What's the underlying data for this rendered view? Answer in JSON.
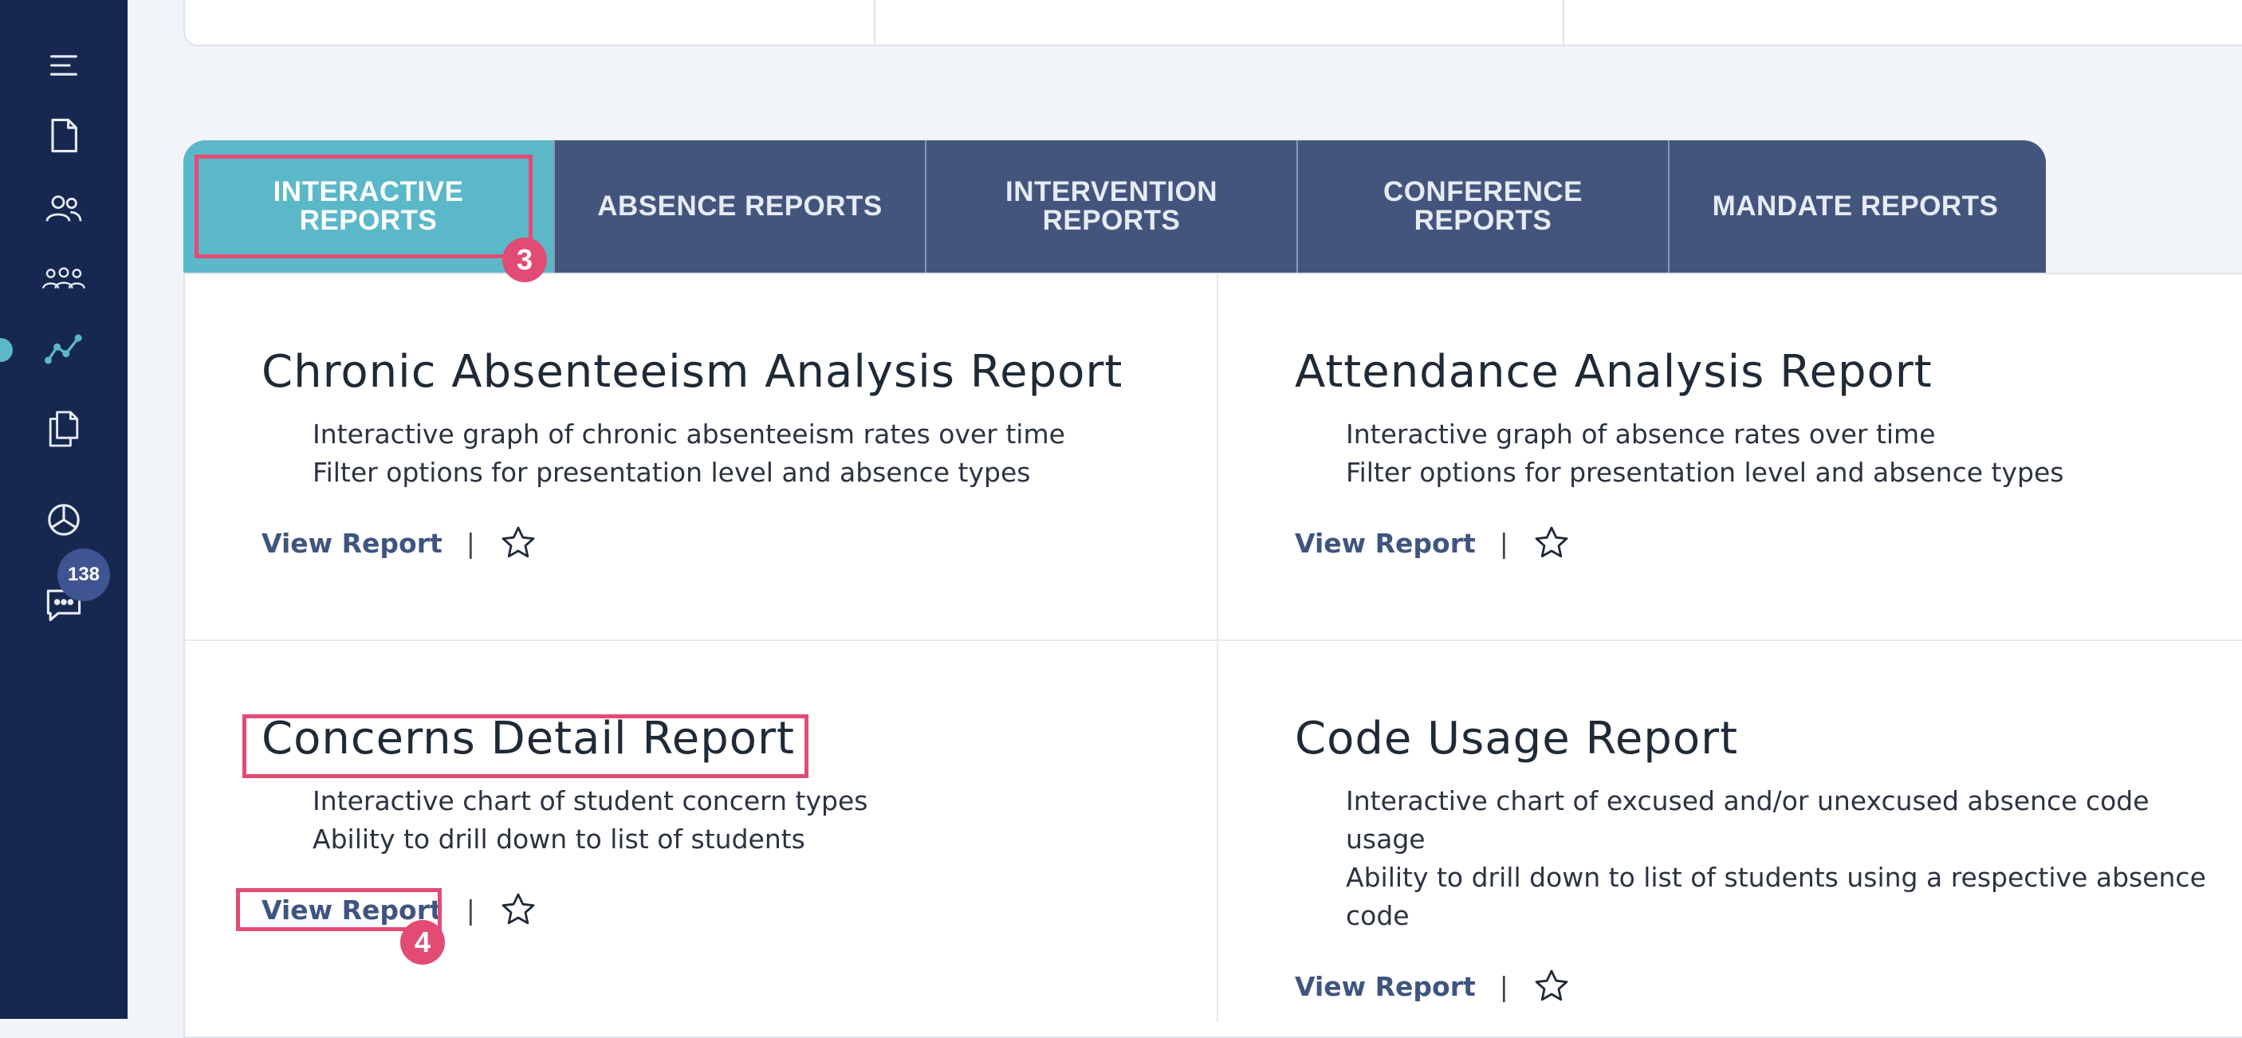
{
  "sidebar": {
    "items": [
      {
        "icon": "menu-icon"
      },
      {
        "icon": "document-icon"
      },
      {
        "icon": "users-icon"
      },
      {
        "icon": "group-icon"
      },
      {
        "icon": "analytics-icon"
      },
      {
        "icon": "copy-documents-icon"
      },
      {
        "icon": "pie-chart-icon"
      },
      {
        "icon": "chat-icon"
      }
    ],
    "active_index": 4,
    "badge_count": "138"
  },
  "tabs": [
    {
      "label": "INTERACTIVE\nREPORTS",
      "active": true
    },
    {
      "label": "ABSENCE REPORTS",
      "active": false
    },
    {
      "label": "INTERVENTION\nREPORTS",
      "active": false
    },
    {
      "label": "CONFERENCE\nREPORTS",
      "active": false
    },
    {
      "label": "MANDATE REPORTS",
      "active": false
    }
  ],
  "reports": [
    {
      "title": "Chronic Absenteeism Analysis Report",
      "lines": [
        "Interactive graph of chronic absenteeism rates over time",
        "Filter options for presentation level and absence types"
      ],
      "link": "View Report",
      "sep": "|"
    },
    {
      "title": "Attendance Analysis Report",
      "lines": [
        "Interactive graph of absence rates over time",
        "Filter options for presentation level and absence types"
      ],
      "link": "View Report",
      "sep": "|"
    },
    {
      "title": "Concerns Detail Report",
      "lines": [
        "Interactive chart of student concern types",
        "Ability to drill down to list of students"
      ],
      "link": "View Report",
      "sep": "|"
    },
    {
      "title": "Code Usage Report",
      "lines": [
        "Interactive chart of excused and/or unexcused absence code usage",
        "Ability to drill down to list of students using a respective absence code"
      ],
      "link": "View Report",
      "sep": "|"
    }
  ],
  "annotations": {
    "step3": "3",
    "step4": "4"
  },
  "colors": {
    "sidebar": "#172850",
    "accent": "#5bb8c8",
    "tab": "#44557d",
    "highlight": "#e24b74",
    "link": "#3f5580"
  }
}
